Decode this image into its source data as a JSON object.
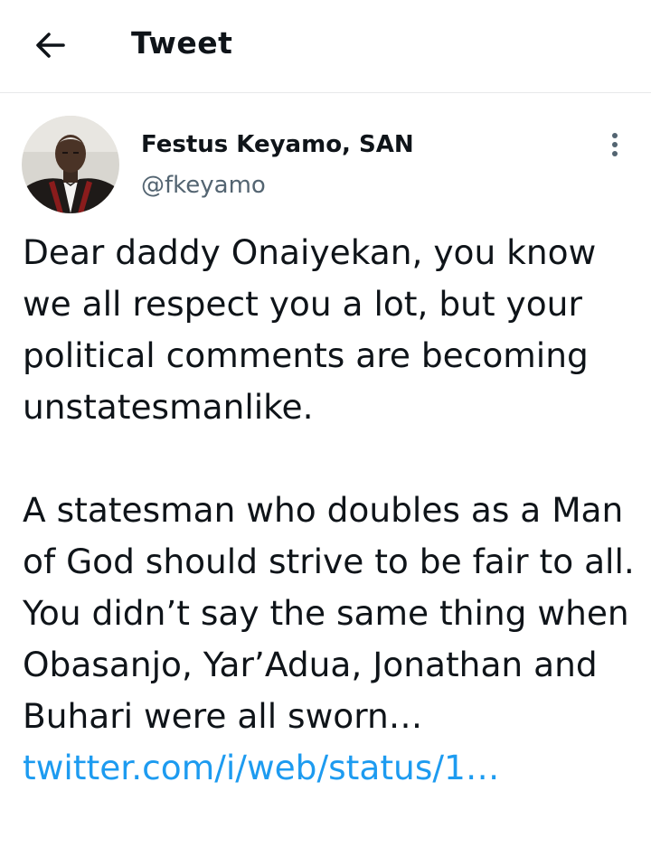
{
  "header": {
    "title": "Tweet",
    "back_icon": "arrow-left-icon"
  },
  "author": {
    "name": "Festus Keyamo, SAN",
    "handle": "@fkeyamo",
    "more_icon": "more-vertical-icon"
  },
  "tweet": {
    "paragraph_1": "Dear daddy Onaiyekan, you know we all respect you a lot, but your political comments are becoming unstatesmanlike.",
    "paragraph_2_text": "A statesman who doubles as a Man of God should strive to be fair to all. You didn’t say the same thing when Obasanjo, Yar’Adua, Jonathan and Buhari were all sworn…",
    "link_text": "twitter.com/i/web/status/1…"
  },
  "colors": {
    "text": "#0f1419",
    "secondary": "#536471",
    "link": "#1d9bf0",
    "divider": "#e7e9ea"
  }
}
